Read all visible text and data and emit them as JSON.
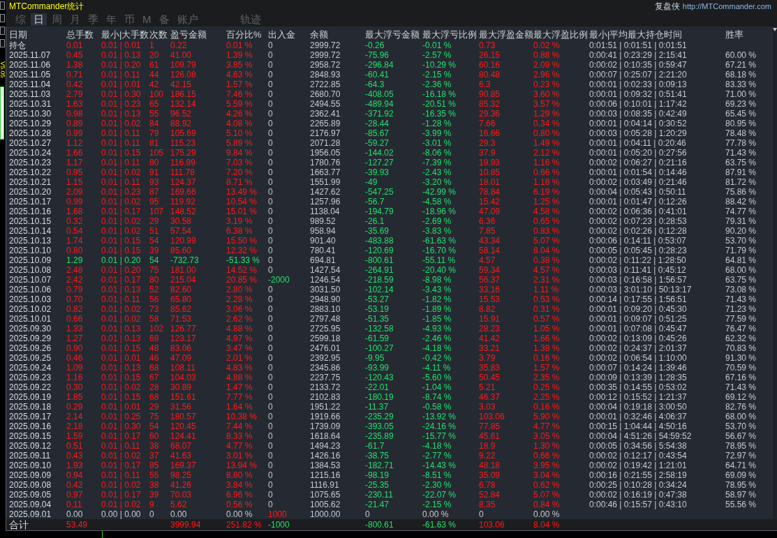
{
  "window": {
    "title": "MTCommander统计",
    "brand": "复盘侠",
    "link": "http://MTCommander.com"
  },
  "side_strip": {
    "version": "V5.05"
  },
  "tabs": [
    {
      "label": "综",
      "selected": false
    },
    {
      "label": "日",
      "selected": true
    },
    {
      "label": "周",
      "selected": false
    },
    {
      "label": "月",
      "selected": false
    },
    {
      "label": "季",
      "selected": false
    },
    {
      "label": "年",
      "selected": false
    },
    {
      "label": "币",
      "selected": false
    },
    {
      "label": "M",
      "selected": false
    },
    {
      "label": "备",
      "selected": false
    },
    {
      "label": "账户",
      "selected": false
    }
  ],
  "extra_tabs": [
    {
      "label": "轨迹",
      "selected": false
    }
  ],
  "table": {
    "columns": [
      "日期",
      "总手数",
      "最小|大手数",
      "次数",
      "盈亏金额",
      "百分比%",
      "出入金",
      "余额",
      "最大浮亏金额",
      "最大浮亏比例",
      "最大浮盈金额",
      "最大浮盈比例",
      "最小|平均最大持仓时间",
      "胜率"
    ],
    "rows": [
      {
        "loss": false,
        "flat": false,
        "deposit": false,
        "withdrawal": false,
        "cells": [
          "持仓",
          "0.01",
          "0.01 | 0.01",
          "1",
          "0.22",
          "0.01 %",
          "0",
          "2999.72",
          "-0.26",
          "-0.01 %",
          "0.73",
          "0.02 %",
          "0:01:51 | 0:01:51 | 0:01:51"
        ]
      },
      {
        "loss": false,
        "flat": false,
        "deposit": false,
        "withdrawal": false,
        "cells": [
          "2025.11.07",
          "0.45",
          "0.01 | 0.13",
          "20",
          "41.00",
          "1.39 %",
          "0",
          "2999.72",
          "-75.96",
          "-2.57 %",
          "26.15",
          "0.88 %",
          "0:00:41 | 0:23:29 | 2:15:41",
          "60.00 %"
        ]
      },
      {
        "loss": false,
        "flat": false,
        "deposit": false,
        "withdrawal": false,
        "cells": [
          "2025.11.06",
          "1.38",
          "0.01 | 0.20",
          "61",
          "109.79",
          "3.85 %",
          "0",
          "2958.72",
          "-296.84",
          "-10.29 %",
          "60.16",
          "2.09 %",
          "0:00:02 | 0:10:35 | 0:59:47",
          "67.21 %"
        ]
      },
      {
        "loss": false,
        "flat": false,
        "deposit": false,
        "withdrawal": false,
        "cells": [
          "2025.11.05",
          "0.71",
          "0.01 | 0.11",
          "44",
          "126.08",
          "4.63 %",
          "0",
          "2848.93",
          "-60.41",
          "-2.15 %",
          "80.48",
          "2.96 %",
          "0:00:07 | 0:25:07 | 2:21:20",
          "68.18 %"
        ]
      },
      {
        "loss": false,
        "flat": false,
        "deposit": false,
        "withdrawal": false,
        "cells": [
          "2025.11.04",
          "0.42",
          "0.01 | 0.01",
          "42",
          "42.15",
          "1.57 %",
          "0",
          "2722.85",
          "-64.3",
          "-2.36 %",
          "6.3",
          "0.23 %",
          "0:00:01 | 0:02:33 | 0:09:13",
          "83.33 %"
        ]
      },
      {
        "loss": false,
        "flat": false,
        "deposit": false,
        "withdrawal": false,
        "cells": [
          "2025.11.03",
          "2.79",
          "0.01 | 0.30",
          "100",
          "186.15",
          "7.46 %",
          "0",
          "2680.70",
          "-408.05",
          "-16.18 %",
          "90.85",
          "3.60 %",
          "0:00:01 | 0:09:32 | 0:51:41",
          "71.00 %"
        ]
      },
      {
        "loss": false,
        "flat": false,
        "deposit": false,
        "withdrawal": false,
        "cells": [
          "2025.10.31",
          "1.63",
          "0.01 | 0.23",
          "65",
          "132.14",
          "5.59 %",
          "0",
          "2494.55",
          "-489.94",
          "-20.51 %",
          "85.32",
          "3.57 %",
          "0:00:06 | 0:10:01 | 1:17:42",
          "69.23 %"
        ]
      },
      {
        "loss": false,
        "flat": false,
        "deposit": false,
        "withdrawal": false,
        "cells": [
          "2025.10.30",
          "0.98",
          "0.01 | 0.13",
          "55",
          "96.52",
          "4.26 %",
          "0",
          "2362.41",
          "-371.92",
          "-16.35 %",
          "29.36",
          "1.29 %",
          "0:00:03 | 0:08:35 | 0:42:49",
          "65.45 %"
        ]
      },
      {
        "loss": false,
        "flat": false,
        "deposit": false,
        "withdrawal": false,
        "cells": [
          "2025.10.29",
          "0.89",
          "0.01 | 0.02",
          "84",
          "88.92",
          "4.08 %",
          "0",
          "2265.89",
          "-28.44",
          "-1.28 %",
          "7.66",
          "0.34 %",
          "0:00:01 | 0:04:14 | 0:30:52",
          "80.95 %"
        ]
      },
      {
        "loss": false,
        "flat": false,
        "deposit": false,
        "withdrawal": false,
        "cells": [
          "2025.10.28",
          "0.99",
          "0.01 | 0.11",
          "79",
          "105.69",
          "5.10 %",
          "0",
          "2176.97",
          "-85.67",
          "-3.99 %",
          "16.66",
          "0.80 %",
          "0:00:03 | 0:05:28 | 1:20:29",
          "78.48 %"
        ]
      },
      {
        "loss": false,
        "flat": false,
        "deposit": false,
        "withdrawal": false,
        "cells": [
          "2025.10.27",
          "1.12",
          "0.01 | 0.11",
          "81",
          "115.23",
          "5.89 %",
          "0",
          "2071.28",
          "-59.27",
          "-3.01 %",
          "29.3",
          "1.49 %",
          "0:00:01 | 0:04:11 | 0:20:46",
          "77.78 %"
        ]
      },
      {
        "loss": false,
        "flat": false,
        "deposit": false,
        "withdrawal": false,
        "cells": [
          "2025.10.24",
          "1.66",
          "0.01 | 0.15",
          "105",
          "175.29",
          "9.84 %",
          "0",
          "1956.05",
          "-144.02",
          "-8.06 %",
          "37.9",
          "2.12 %",
          "0:00:01 | 0:05:20 | 0:27:56",
          "71.43 %"
        ]
      },
      {
        "loss": false,
        "flat": false,
        "deposit": false,
        "withdrawal": false,
        "cells": [
          "2025.10.23",
          "1.17",
          "0.01 | 0.11",
          "80",
          "116.99",
          "7.03 %",
          "0",
          "1780.76",
          "-127.27",
          "-7.39 %",
          "19.93",
          "1.16 %",
          "0:00:02 | 0:06:27 | 0:21:16",
          "63.75 %"
        ]
      },
      {
        "loss": false,
        "flat": false,
        "deposit": false,
        "withdrawal": false,
        "cells": [
          "2025.10.22",
          "0.95",
          "0.01 | 0.02",
          "91",
          "111.78",
          "7.20 %",
          "0",
          "1663.77",
          "-39.93",
          "-2.43 %",
          "10.85",
          "0.66 %",
          "0:00:01 | 0:01:54 | 0:14:46",
          "87.91 %"
        ]
      },
      {
        "loss": false,
        "flat": false,
        "deposit": false,
        "withdrawal": false,
        "cells": [
          "2025.10.21",
          "1.15",
          "0.01 | 0.11",
          "93",
          "124.37",
          "8.71 %",
          "0",
          "1551.99",
          "-49",
          "-3.20 %",
          "18.01",
          "1.18 %",
          "0:00:02 | 0:03:49 | 0:21:46",
          "81.72 %"
        ]
      },
      {
        "loss": false,
        "flat": false,
        "deposit": false,
        "withdrawal": false,
        "cells": [
          "2025.10.20",
          "2.09",
          "0.01 | 0.23",
          "87",
          "169.66",
          "13.49 %",
          "0",
          "1427.62",
          "-547.25",
          "-42.99 %",
          "78.84",
          "6.19 %",
          "0:00:04 | 0:05:43 | 0:50:11",
          "75.86 %"
        ]
      },
      {
        "loss": false,
        "flat": false,
        "deposit": false,
        "withdrawal": false,
        "cells": [
          "2025.10.17",
          "0.99",
          "0.01 | 0.02",
          "95",
          "119.92",
          "10.54 %",
          "0",
          "1257.96",
          "-56.7",
          "-4.58 %",
          "15.42",
          "1.25 %",
          "0:00:01 | 0:01:47 | 0:12:26",
          "88.42 %"
        ]
      },
      {
        "loss": false,
        "flat": false,
        "deposit": false,
        "withdrawal": false,
        "cells": [
          "2025.10.16",
          "1.68",
          "0.01 | 0.17",
          "107",
          "148.52",
          "15.01 %",
          "0",
          "1138.04",
          "-194.79",
          "-18.96 %",
          "47.09",
          "4.58 %",
          "0:00:02 | 0:06:36 | 0:41:01",
          "74.77 %"
        ]
      },
      {
        "loss": false,
        "flat": false,
        "deposit": false,
        "withdrawal": false,
        "cells": [
          "2025.10.15",
          "0.32",
          "0.01 | 0.02",
          "29",
          "30.58",
          "3.19 %",
          "0",
          "989.52",
          "-26.1",
          "-2.69 %",
          "6.36",
          "0.65 %",
          "0:00:02 | 0:07:23 | 0:28:53",
          "79.31 %"
        ]
      },
      {
        "loss": false,
        "flat": false,
        "deposit": false,
        "withdrawal": false,
        "cells": [
          "2025.10.14",
          "0.54",
          "0.01 | 0.02",
          "51",
          "57.54",
          "6.38 %",
          "0",
          "958.94",
          "-35.69",
          "-3.83 %",
          "7.85",
          "0.83 %",
          "0:00:02 | 0:02:26 | 0:12:28",
          "90.20 %"
        ]
      },
      {
        "loss": false,
        "flat": false,
        "deposit": false,
        "withdrawal": false,
        "cells": [
          "2025.10.13",
          "1.74",
          "0.01 | 0.15",
          "54",
          "120.99",
          "15.50 %",
          "0",
          "901.40",
          "-483.88",
          "-61.63 %",
          "43.34",
          "5.07 %",
          "0:00:06 | 0:14:11 | 0:53:07",
          "53.70 %"
        ]
      },
      {
        "loss": false,
        "flat": false,
        "deposit": false,
        "withdrawal": false,
        "cells": [
          "2025.10.10",
          "0.80",
          "0.01 | 0.15",
          "39",
          "85.60",
          "12.32 %",
          "0",
          "780.41",
          "-120.69",
          "-16.70 %",
          "58.14",
          "8.04 %",
          "0:00:05 | 0:05:45 | 0:28:23",
          "71.79 %"
        ]
      },
      {
        "loss": true,
        "flat": false,
        "deposit": false,
        "withdrawal": false,
        "cells": [
          "2025.10.09",
          "1.29",
          "0.01 | 0.20",
          "54",
          "-732.73",
          "-51.33 %",
          "0",
          "694.81",
          "-800.61",
          "-55.11 %",
          "4.57",
          "0.38 %",
          "0:00:02 | 0:11:22 | 1:28:50",
          "64.81 %"
        ]
      },
      {
        "loss": false,
        "flat": false,
        "deposit": false,
        "withdrawal": false,
        "cells": [
          "2025.10.08",
          "2.48",
          "0.01 | 0.20",
          "75",
          "181.00",
          "14.52 %",
          "0",
          "1427.54",
          "-264.91",
          "-20.40 %",
          "59.34",
          "4.57 %",
          "0:00:03 | 0:11:41 | 0:45:12",
          "68.00 %"
        ]
      },
      {
        "loss": false,
        "flat": false,
        "deposit": false,
        "withdrawal": true,
        "cells": [
          "2025.10.07",
          "2.42",
          "0.01 | 0.17",
          "80",
          "215.04",
          "20.85 %",
          "-2000",
          "1246.54",
          "-218.59",
          "-8.98 %",
          "56.37",
          "2.31 %",
          "0:00:03 | 0:16:58 | 1:56:57",
          "63.75 %"
        ]
      },
      {
        "loss": false,
        "flat": false,
        "deposit": false,
        "withdrawal": false,
        "cells": [
          "2025.10.06",
          "0.79",
          "0.01 | 0.13",
          "52",
          "82.60",
          "2.80 %",
          "0",
          "3031.50",
          "-102.14",
          "-3.43 %",
          "33.16",
          "1.11 %",
          "0:00:03 | 3:01:10 | 50:13:17",
          "73.08 %"
        ]
      },
      {
        "loss": false,
        "flat": false,
        "deposit": false,
        "withdrawal": false,
        "cells": [
          "2025.10.03",
          "0.70",
          "0.01 | 0.11",
          "56",
          "65.80",
          "2.28 %",
          "0",
          "2948.90",
          "-53.27",
          "-1.82 %",
          "15.53",
          "0.53 %",
          "0:00:14 | 0:17:55 | 1:56:51",
          "71.43 %"
        ]
      },
      {
        "loss": false,
        "flat": false,
        "deposit": false,
        "withdrawal": false,
        "cells": [
          "2025.10.02",
          "0.82",
          "0.01 | 0.02",
          "73",
          "85.62",
          "3.06 %",
          "0",
          "2883.10",
          "-53.19",
          "-1.89 %",
          "8.82",
          "0.31 %",
          "0:00:01 | 0:09:20 | 0:45:30",
          "71.23 %"
        ]
      },
      {
        "loss": false,
        "flat": false,
        "deposit": false,
        "withdrawal": false,
        "cells": [
          "2025.10.01",
          "0.66",
          "0.01 | 0.02",
          "58",
          "71.53",
          "2.62 %",
          "0",
          "2797.48",
          "-51.35",
          "-1.85 %",
          "15.91",
          "0.57 %",
          "0:00:01 | 0:09:07 | 0:51:25",
          "77.59 %"
        ]
      },
      {
        "loss": false,
        "flat": false,
        "deposit": false,
        "withdrawal": false,
        "cells": [
          "2025.09.30",
          "1.33",
          "0.01 | 0.13",
          "102",
          "126.77",
          "4.88 %",
          "0",
          "2725.95",
          "-132.58",
          "-4.93 %",
          "28.23",
          "1.05 %",
          "0:00:01 | 0:07:08 | 0:45:47",
          "76.47 %"
        ]
      },
      {
        "loss": false,
        "flat": false,
        "deposit": false,
        "withdrawal": false,
        "cells": [
          "2025.09.29",
          "1.27",
          "0.01 | 0.13",
          "69",
          "123.17",
          "4.97 %",
          "0",
          "2599.18",
          "-61.59",
          "-2.46 %",
          "41.42",
          "1.66 %",
          "0:00:02 | 0:13:09 | 0:45:26",
          "62.32 %"
        ]
      },
      {
        "loss": false,
        "flat": false,
        "deposit": false,
        "withdrawal": false,
        "cells": [
          "2025.09.26",
          "0.90",
          "0.01 | 0.15",
          "48",
          "83.06",
          "3.47 %",
          "0",
          "2476.01",
          "-100.27",
          "-4.18 %",
          "33.21",
          "1.38 %",
          "0:00:02 | 0:24:37 | 2:01:37",
          "70.83 %"
        ]
      },
      {
        "loss": false,
        "flat": false,
        "deposit": false,
        "withdrawal": false,
        "cells": [
          "2025.09.25",
          "0.46",
          "0.01 | 0.01",
          "46",
          "47.09",
          "2.01 %",
          "0",
          "2392.95",
          "-9.95",
          "-0.42 %",
          "3.79",
          "0.16 %",
          "0:00:02 | 0:06:54 | 1:10:00",
          "91.30 %"
        ]
      },
      {
        "loss": false,
        "flat": false,
        "deposit": false,
        "withdrawal": false,
        "cells": [
          "2025.09.24",
          "1.09",
          "0.01 | 0.13",
          "68",
          "108.11",
          "4.83 %",
          "0",
          "2345.86",
          "-93.99",
          "-4.11 %",
          "35.83",
          "1.57 %",
          "0:00:07 | 0:14:24 | 1:39:46",
          "70.59 %"
        ]
      },
      {
        "loss": false,
        "flat": false,
        "deposit": false,
        "withdrawal": false,
        "cells": [
          "2025.09.23",
          "1.16",
          "0.01 | 0.15",
          "67",
          "104.03",
          "4.88 %",
          "0",
          "2237.75",
          "-120.43",
          "-5.60 %",
          "50.45",
          "2.35 %",
          "0:00:09 | 0:13:39 | 1:28:35",
          "67.16 %"
        ]
      },
      {
        "loss": false,
        "flat": false,
        "deposit": false,
        "withdrawal": false,
        "cells": [
          "2025.09.22",
          "0.30",
          "0.01 | 0.02",
          "28",
          "30.89",
          "1.47 %",
          "0",
          "2133.72",
          "-22.01",
          "-1.04 %",
          "5.21",
          "0.25 %",
          "0:00:35 | 0:14:55 | 0:53:02",
          "71.43 %"
        ]
      },
      {
        "loss": false,
        "flat": false,
        "deposit": false,
        "withdrawal": false,
        "cells": [
          "2025.09.19",
          "1.85",
          "0.01 | 0.15",
          "68",
          "151.61",
          "7.77 %",
          "0",
          "2102.83",
          "-180.19",
          "-8.74 %",
          "46.37",
          "2.25 %",
          "0:00:12 | 0:15:52 | 1:21:37",
          "69.12 %"
        ]
      },
      {
        "loss": false,
        "flat": false,
        "deposit": false,
        "withdrawal": false,
        "cells": [
          "2025.09.18",
          "0.29",
          "0.01 | 0.01",
          "29",
          "31.56",
          "1.64 %",
          "0",
          "1951.22",
          "-11.37",
          "-0.58 %",
          "3.03",
          "0.16 %",
          "0:00:04 | 0:19:18 | 3:00:50",
          "82.76 %"
        ]
      },
      {
        "loss": false,
        "flat": false,
        "deposit": false,
        "withdrawal": false,
        "cells": [
          "2025.09.17",
          "2.14",
          "0.01 | 0.25",
          "75",
          "180.57",
          "10.38 %",
          "0",
          "1919.66",
          "-235.29",
          "-13.92 %",
          "103.06",
          "5.90 %",
          "0:00:01 | 0:32:46 | 4:06:37",
          "68.00 %"
        ]
      },
      {
        "loss": false,
        "flat": false,
        "deposit": false,
        "withdrawal": false,
        "cells": [
          "2025.09.16",
          "2.18",
          "0.01 | 0.30",
          "54",
          "120.45",
          "7.44 %",
          "0",
          "1739.09",
          "-393.05",
          "-24.16 %",
          "77.85",
          "4.77 %",
          "0:00:15 | 1:04:44 | 4:50:16",
          "53.70 %"
        ]
      },
      {
        "loss": false,
        "flat": false,
        "deposit": false,
        "withdrawal": false,
        "cells": [
          "2025.09.15",
          "1.59",
          "0.01 | 0.17",
          "60",
          "124.41",
          "8.33 %",
          "0",
          "1618.64",
          "-235.89",
          "-15.77 %",
          "45.61",
          "3.05 %",
          "0:00:04 | 4:51:26 | 54:59:52",
          "56.67 %"
        ]
      },
      {
        "loss": false,
        "flat": false,
        "deposit": false,
        "withdrawal": false,
        "cells": [
          "2025.09.12",
          "0.51",
          "0.01 | 0.11",
          "38",
          "68.07",
          "4.77 %",
          "0",
          "1494.23",
          "-61.7",
          "-4.18 %",
          "18.9",
          "1.30 %",
          "0:00:05 | 0:34:56 | 5:54:38",
          "78.95 %"
        ]
      },
      {
        "loss": false,
        "flat": false,
        "deposit": false,
        "withdrawal": false,
        "cells": [
          "2025.09.11",
          "0.43",
          "0.01 | 0.02",
          "37",
          "41.63",
          "3.01 %",
          "0",
          "1426.16",
          "-38.75",
          "-2.77 %",
          "9.22",
          "0.66 %",
          "0:00:02 | 0:12:17 | 0:43:54",
          "72.97 %"
        ]
      },
      {
        "loss": false,
        "flat": false,
        "deposit": false,
        "withdrawal": false,
        "cells": [
          "2025.09.10",
          "1.93",
          "0.01 | 0.17",
          "85",
          "169.37",
          "13.94 %",
          "0",
          "1384.53",
          "-182.71",
          "-14.43 %",
          "48.18",
          "3.95 %",
          "0:00:02 | 0:19:42 | 1:21:01",
          "64.71 %"
        ]
      },
      {
        "loss": false,
        "flat": false,
        "deposit": false,
        "withdrawal": false,
        "cells": [
          "2025.09.09",
          "0.94",
          "0.01 | 0.11",
          "55",
          "98.25",
          "8.80 %",
          "0",
          "1215.16",
          "-98.19",
          "-8.51 %",
          "35.09",
          "3.04 %",
          "0:00:16 | 0:21:55 | 2:58:19",
          "69.09 %"
        ]
      },
      {
        "loss": false,
        "flat": false,
        "deposit": false,
        "withdrawal": false,
        "cells": [
          "2025.09.08",
          "0.42",
          "0.01 | 0.02",
          "38",
          "41.26",
          "3.84 %",
          "0",
          "1116.91",
          "-25.35",
          "-2.30 %",
          "6.78",
          "0.62 %",
          "0:00:25 | 0:10:28 | 0:34:24",
          "78.95 %"
        ]
      },
      {
        "loss": false,
        "flat": false,
        "deposit": false,
        "withdrawal": false,
        "cells": [
          "2025.09.05",
          "0.97",
          "0.01 | 0.17",
          "39",
          "70.03",
          "6.96 %",
          "0",
          "1075.65",
          "-230.11",
          "-22.07 %",
          "52.84",
          "5.07 %",
          "0:00:02 | 0:16:19 | 0:47:38",
          "58.97 %"
        ]
      },
      {
        "loss": false,
        "flat": false,
        "deposit": false,
        "withdrawal": false,
        "cells": [
          "2025.09.04",
          "0.11",
          "0.01 | 0.02",
          "9",
          "5.62",
          "0.56 %",
          "0",
          "1005.62",
          "-21.47",
          "-2.15 %",
          "8.35",
          "0.84 %",
          "0:00:46 | 0:15:57 | 0:43:10",
          "55.56 %"
        ]
      },
      {
        "flat": true,
        "deposit": true,
        "cells": [
          "2025.09.01",
          "0.00",
          "0.00 | 0.00",
          "0",
          "0.00",
          "0.00 %",
          "1000",
          "1000.00",
          "0",
          "0.00 %",
          "0",
          "0.00 %"
        ]
      }
    ],
    "total": {
      "label": "合计",
      "lots": "53.49",
      "pnl": "3999.94",
      "pct": "251.82 %",
      "flow": "-1000",
      "deposit": false,
      "withdrawal": true,
      "max_loss": "-800.61",
      "max_loss_pct": "-61.63 %",
      "max_profit": "103.06",
      "max_profit_pct": "8.04 %"
    }
  }
}
